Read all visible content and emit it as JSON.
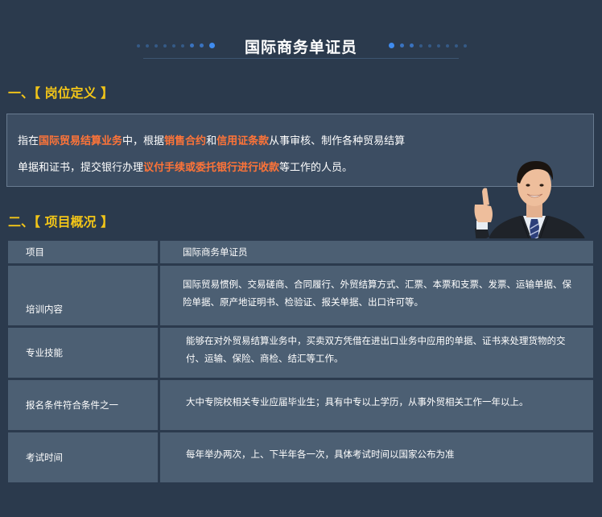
{
  "header": {
    "title": "国际商务单证员"
  },
  "sections": {
    "definition_heading": "一、【 岗位定义 】",
    "overview_heading": "二、【 项目概况 】"
  },
  "definition": {
    "line1": [
      {
        "text": "指在",
        "highlight": false
      },
      {
        "text": "国际贸易结算业务",
        "highlight": true
      },
      {
        "text": "中，根据",
        "highlight": false
      },
      {
        "text": "销售合约",
        "highlight": true
      },
      {
        "text": "和",
        "highlight": false
      },
      {
        "text": "信用证条款",
        "highlight": true
      },
      {
        "text": "从事审核、制作各种贸易结算",
        "highlight": false
      }
    ],
    "line2": [
      {
        "text": "单据和证书，提交银行办理",
        "highlight": false
      },
      {
        "text": "议付手续或委托银行进行收款",
        "highlight": true
      },
      {
        "text": "等工作的人员。",
        "highlight": false
      }
    ]
  },
  "table": {
    "header": {
      "label": "项目",
      "value": "国际商务单证员"
    },
    "rows": [
      {
        "label": "培训内容",
        "value": "国际贸易惯例、交易磋商、合同履行、外贸结算方式、汇票、本票和支票、发票、运输单据、保险单据、原产地证明书、检验证、报关单据、出口许可等。"
      },
      {
        "label": "专业技能",
        "value": "能够在对外贸易结算业务中，买卖双方凭借在进出口业务中应用的单据、证书来处理货物的交付、运输、保险、商检、结汇等工作。"
      },
      {
        "label": "报名条件符合条件之一",
        "value": "大中专院校相关专业应届毕业生；具有中专以上学历，从事外贸相关工作一年以上。"
      },
      {
        "label": "考试时间",
        "value": "每年举办两次，上、下半年各一次，具体考试时间以国家公布为准"
      }
    ]
  },
  "colors": {
    "background": "#2b3a4d",
    "heading": "#f2c518",
    "highlight": "#ff7438",
    "cell": "#4c5f73",
    "accent_blue": "#3f8cf0"
  }
}
